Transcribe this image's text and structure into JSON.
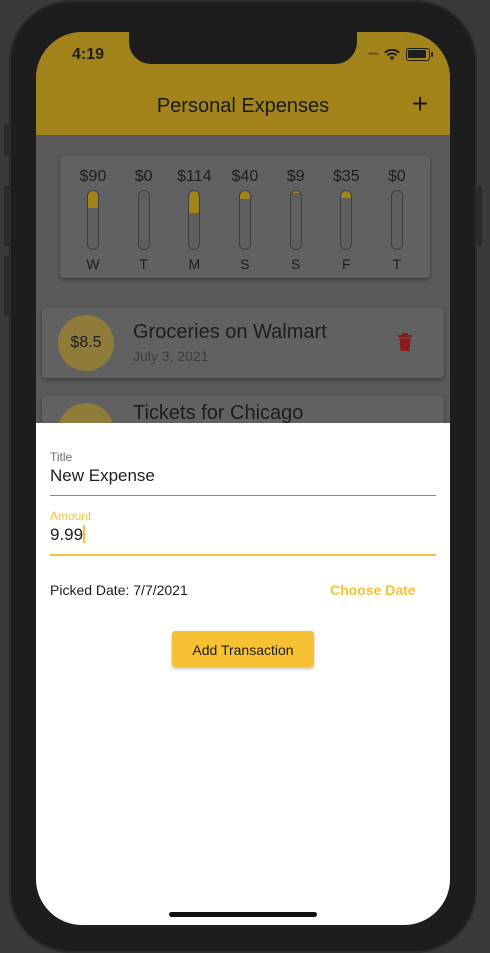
{
  "status_bar": {
    "time": "4:19"
  },
  "app_bar": {
    "title": "Personal Expenses",
    "add_label": "+"
  },
  "chart": {
    "bars": [
      {
        "amount": "$90",
        "day": "W",
        "fraction": 0.3
      },
      {
        "amount": "$0",
        "day": "T",
        "fraction": 0.0
      },
      {
        "amount": "$114",
        "day": "M",
        "fraction": 0.38
      },
      {
        "amount": "$40",
        "day": "S",
        "fraction": 0.14
      },
      {
        "amount": "$9",
        "day": "S",
        "fraction": 0.04
      },
      {
        "amount": "$35",
        "day": "F",
        "fraction": 0.12
      },
      {
        "amount": "$0",
        "day": "T",
        "fraction": 0.0
      }
    ]
  },
  "transactions": [
    {
      "amount": "$8.5",
      "title": "Groceries on Walmart",
      "date": "July 3, 2021"
    },
    {
      "amount": "",
      "title": "Tickets for Chicago",
      "date": ""
    }
  ],
  "sheet": {
    "title_label": "Title",
    "title_value": "New Expense",
    "amount_label": "Amount",
    "amount_value": "9.99",
    "picked_date": "Picked Date: 7/7/2021",
    "choose_date": "Choose Date",
    "add_button": "Add Transaction"
  },
  "colors": {
    "accent": "#f6c132",
    "appbar_dimmed": "#a3841a",
    "delete": "#8b1a1a"
  }
}
